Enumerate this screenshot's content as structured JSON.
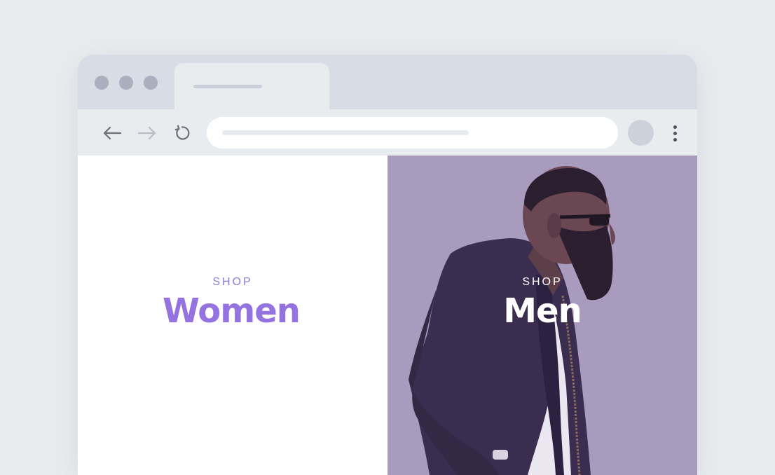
{
  "window": {
    "tab_count": 1,
    "controls": [
      "close",
      "minimize",
      "maximize"
    ]
  },
  "toolbar": {
    "back_icon": "arrow-left-icon",
    "forward_icon": "arrow-right-icon",
    "reload_icon": "reload-icon",
    "menu_icon": "kebab-menu-icon"
  },
  "panels": {
    "women": {
      "eyebrow": "SHOP",
      "title": "Women",
      "eyebrow_color": "#8c7ad6",
      "title_color": "#9472e0",
      "background": "#ffffff"
    },
    "men": {
      "eyebrow": "SHOP",
      "title": "Men",
      "text_color": "#ffffff",
      "background": "#a99bbd",
      "photo": "man-in-sunglasses-photo"
    }
  },
  "colors": {
    "page_background": "#e9ecef",
    "tabbar": "#d8dce5",
    "accent": "#9472e0"
  }
}
